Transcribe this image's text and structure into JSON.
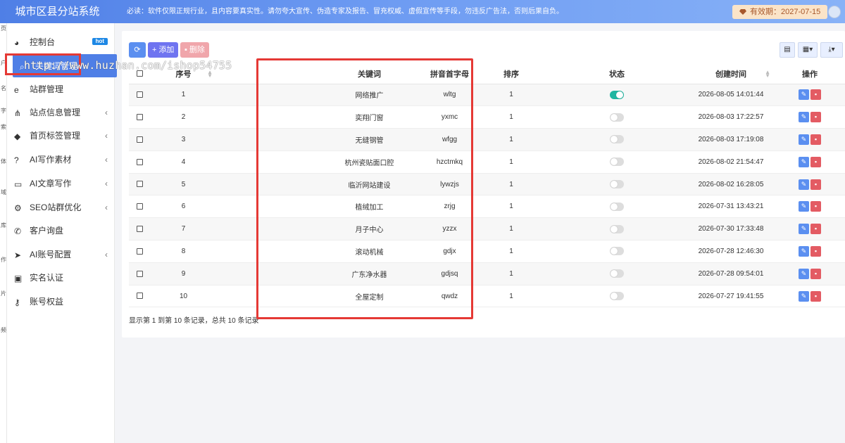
{
  "app": {
    "brand": "城市区县分站系统",
    "notice": "必读：软件仅限正规行业，且内容要真实性。请勿夸大宣传、伪造专家及报告、冒充权威、虚假宣传等手段，勿违反广告法，否则后果自负。",
    "expiry": "有效期：2027-07-15"
  },
  "strip": [
    "页",
    "户",
    "名",
    "字",
    "索",
    "体",
    "域",
    "库",
    "作",
    "片",
    "频"
  ],
  "sidebar": {
    "items": [
      {
        "label": "控制台",
        "icon": "dashboard-icon",
        "badge": "hot"
      },
      {
        "label": "关键词管理",
        "icon": "search-icon",
        "active": true
      },
      {
        "label": "站群管理",
        "icon": "ie-icon"
      },
      {
        "label": "站点信息管理",
        "icon": "sitemap-icon",
        "arrow": "‹"
      },
      {
        "label": "首页标签管理",
        "icon": "tag-icon",
        "arrow": "‹"
      },
      {
        "label": "AI写作素材",
        "icon": "question-icon",
        "arrow": "‹"
      },
      {
        "label": "AI文章写作",
        "icon": "folder-icon",
        "arrow": "‹"
      },
      {
        "label": "SEO站群优化",
        "icon": "cogs-icon",
        "arrow": "‹"
      },
      {
        "label": "客户询盘",
        "icon": "phone-icon"
      },
      {
        "label": "AI账号配置",
        "icon": "rocket-icon",
        "arrow": "‹"
      },
      {
        "label": "实名认证",
        "icon": "id-card-icon"
      },
      {
        "label": "账号权益",
        "icon": "key-icon"
      }
    ]
  },
  "toolbar": {
    "refresh_icon": "⟳",
    "add_label": "添加",
    "delete_label": "删除"
  },
  "table": {
    "columns": [
      "序号",
      "关键词",
      "拼音首字母",
      "排序",
      "状态",
      "创建时间",
      "操作"
    ],
    "rows": [
      {
        "no": "1",
        "keyword": "网络推广",
        "pinyin": "wltg",
        "sort": "1",
        "status": true,
        "created": "2026-08-05 14:01:44"
      },
      {
        "no": "2",
        "keyword": "奕翔门窗",
        "pinyin": "yxmc",
        "sort": "1",
        "status": false,
        "created": "2026-08-03 17:22:57"
      },
      {
        "no": "3",
        "keyword": "无缝钢管",
        "pinyin": "wfgg",
        "sort": "1",
        "status": false,
        "created": "2026-08-03 17:19:08"
      },
      {
        "no": "4",
        "keyword": "杭州瓷贴面口腔",
        "pinyin": "hzctmkq",
        "sort": "1",
        "status": false,
        "created": "2026-08-02 21:54:47"
      },
      {
        "no": "5",
        "keyword": "临沂网站建设",
        "pinyin": "lywzjs",
        "sort": "1",
        "status": false,
        "created": "2026-08-02 16:28:05"
      },
      {
        "no": "6",
        "keyword": "植绒加工",
        "pinyin": "zrjg",
        "sort": "1",
        "status": false,
        "created": "2026-07-31 13:43:21"
      },
      {
        "no": "7",
        "keyword": "月子中心",
        "pinyin": "yzzx",
        "sort": "1",
        "status": false,
        "created": "2026-07-30 17:33:48"
      },
      {
        "no": "8",
        "keyword": "滚动机械",
        "pinyin": "gdjx",
        "sort": "1",
        "status": false,
        "created": "2026-07-28 12:46:30"
      },
      {
        "no": "9",
        "keyword": "广东净水器",
        "pinyin": "gdjsq",
        "sort": "1",
        "status": false,
        "created": "2026-07-28 09:54:01"
      },
      {
        "no": "10",
        "keyword": "全屋定制",
        "pinyin": "qwdz",
        "sort": "1",
        "status": false,
        "created": "2026-07-27 19:41:55"
      }
    ]
  },
  "pagination": {
    "summary": "显示第 1 到第 10 条记录，总共 10 条记录"
  },
  "watermark": "http://www.huzhan.com/ishop54755",
  "colors": {
    "topbar": "#4f7fe6",
    "active_menu": "#4f7fe6",
    "toggle_on": "#1fb6a1",
    "edit_button": "#5b8ff0",
    "delete_button": "#e35b63",
    "highlight_box": "#e53935"
  }
}
